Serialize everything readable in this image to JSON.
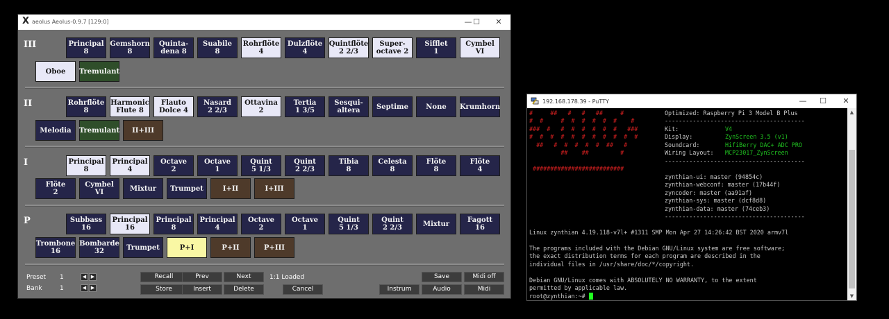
{
  "aeolus": {
    "title": "aeolus  Aeolus-0.9.7  [129:0]",
    "controls": {
      "minimize": "—",
      "maximize": "☐",
      "close": "✕"
    },
    "divisions": [
      {
        "label": "III",
        "row1": [
          {
            "name": "Principal\n8",
            "state": "off"
          },
          {
            "name": "Gemshorn\n8",
            "state": "off"
          },
          {
            "name": "Quinta-\ndena 8",
            "state": "off"
          },
          {
            "name": "Suabile\n8",
            "state": "off"
          },
          {
            "name": "Rohrflöte\n4",
            "state": "on"
          },
          {
            "name": "Dulzflöte\n4",
            "state": "off"
          },
          {
            "name": "Quintflöte\n2 2/3",
            "state": "on"
          },
          {
            "name": "Super-\noctave 2",
            "state": "on"
          },
          {
            "name": "Sifflet\n1",
            "state": "off"
          },
          {
            "name": "Cymbel\nVI",
            "state": "on"
          }
        ],
        "row2": [
          {
            "name": "Oboe",
            "state": "on"
          },
          {
            "name": "Tremulant",
            "state": "trem"
          }
        ]
      },
      {
        "label": "II",
        "row1": [
          {
            "name": "Rohrflöte\n8",
            "state": "off"
          },
          {
            "name": "Harmonic\nFlute 8",
            "state": "on"
          },
          {
            "name": "Flauto\nDolce 4",
            "state": "on"
          },
          {
            "name": "Nasard\n2 2/3",
            "state": "off"
          },
          {
            "name": "Ottavina\n2",
            "state": "on"
          },
          {
            "name": "Tertia\n1 3/5",
            "state": "off"
          },
          {
            "name": "Sesqui-\naltera",
            "state": "off"
          },
          {
            "name": "Septime",
            "state": "off"
          },
          {
            "name": "None",
            "state": "off"
          },
          {
            "name": "Krumhorn",
            "state": "off"
          }
        ],
        "row2": [
          {
            "name": "Melodia",
            "state": "off"
          },
          {
            "name": "Tremulant",
            "state": "trem"
          },
          {
            "name": "II+III",
            "state": "coup"
          }
        ]
      },
      {
        "label": "I",
        "row1": [
          {
            "name": "Principal\n8",
            "state": "on"
          },
          {
            "name": "Principal\n4",
            "state": "on"
          },
          {
            "name": "Octave\n2",
            "state": "off"
          },
          {
            "name": "Octave\n1",
            "state": "off"
          },
          {
            "name": "Quint\n5 1/3",
            "state": "off"
          },
          {
            "name": "Quint\n2 2/3",
            "state": "off"
          },
          {
            "name": "Tibia\n8",
            "state": "off"
          },
          {
            "name": "Celesta\n8",
            "state": "off"
          },
          {
            "name": "Flöte\n8",
            "state": "off"
          },
          {
            "name": "Flöte\n4",
            "state": "off"
          }
        ],
        "row2": [
          {
            "name": "Flöte\n2",
            "state": "off"
          },
          {
            "name": "Cymbel\nVI",
            "state": "off"
          },
          {
            "name": "Mixtur",
            "state": "off"
          },
          {
            "name": "Trumpet",
            "state": "off"
          },
          {
            "name": "I+II",
            "state": "coup"
          },
          {
            "name": "I+III",
            "state": "coup"
          }
        ]
      },
      {
        "label": "P",
        "row1": [
          {
            "name": "Subbass\n16",
            "state": "off"
          },
          {
            "name": "Principal\n16",
            "state": "on"
          },
          {
            "name": "Principal\n8",
            "state": "off"
          },
          {
            "name": "Principal\n4",
            "state": "off"
          },
          {
            "name": "Octave\n2",
            "state": "off"
          },
          {
            "name": "Octave\n1",
            "state": "off"
          },
          {
            "name": "Quint\n5 1/3",
            "state": "off"
          },
          {
            "name": "Quint\n2 2/3",
            "state": "off"
          },
          {
            "name": "Mixtur",
            "state": "off"
          },
          {
            "name": "Fagott\n16",
            "state": "off"
          }
        ],
        "row2": [
          {
            "name": "Trombone\n16",
            "state": "off"
          },
          {
            "name": "Bombarde\n32",
            "state": "off"
          },
          {
            "name": "Trumpet",
            "state": "off"
          },
          {
            "name": "P+I",
            "state": "coup-on"
          },
          {
            "name": "P+II",
            "state": "coup"
          },
          {
            "name": "P+III",
            "state": "coup"
          }
        ]
      }
    ],
    "control": {
      "preset_label": "Preset",
      "preset_value": "1",
      "bank_label": "Bank",
      "bank_value": "1",
      "left_arrow": "◀",
      "right_arrow": "▶",
      "recall": "Recall",
      "prev": "Prev",
      "next": "Next",
      "store": "Store",
      "insert": "Insert",
      "delete": "Delete",
      "status": "1:1  Loaded",
      "cancel": "Cancel",
      "save": "Save",
      "midi_off": "Midi off",
      "instrum": "Instrum",
      "audio": "Audio",
      "midi": "Midi"
    }
  },
  "putty": {
    "title": "192.168.178.39 - PuTTY",
    "controls": {
      "minimize": "—",
      "maximize": "☐",
      "close": "✕"
    },
    "logo_lines": [
      "#     ##   #   #   ##     #    ",
      "#  #     #  #  #  #  #  #    # ",
      "###  #   #  #  #  #  #  #   ###",
      "#  #  #  #  #  #  #  #  #  #  #",
      "  ##   #  #  #  #  #  ##   #  ",
      "         ##    ##         #    ",
      "                               ",
      " ##########################    "
    ],
    "info": {
      "optimized": "Optimized: Raspberry Pi 3 Model B Plus",
      "dash1": "----------------------------------------",
      "kit_label": "Kit:",
      "kit_value": "V4",
      "display_label": "Display:",
      "display_value": "ZynScreen 3.5 (v1)",
      "soundcard_label": "Soundcard:",
      "soundcard_value": "HifiBerry DAC+ ADC PRO",
      "wiring_label": "Wiring Layout:",
      "wiring_value": "MCP23017_ZynScreen",
      "dash2": "----------------------------------------",
      "ui": "zynthian-ui: master (94854c)",
      "webconf": "zynthian-webconf: master (17b44f)",
      "coder": "zyncoder: master (aa91af)",
      "sys": "zynthian-sys: master (dcf8d8)",
      "dataline": "zynthian-data: master (74ceb3)",
      "dash3": "----------------------------------------"
    },
    "linux": "Linux zynthian 4.19.118-v7l+ #1311 SMP Mon Apr 27 14:26:42 BST 2020 armv7l",
    "gnu1": "The programs included with the Debian GNU/Linux system are free software;",
    "gnu2": "the exact distribution terms for each program are described in the",
    "gnu3": "individual files in /usr/share/doc/*/copyright.",
    "warranty1": "Debian GNU/Linux comes with ABSOLUTELY NO WARRANTY, to the extent",
    "warranty2": "permitted by applicable law.",
    "prompt": "root@zynthian:~# ",
    "scroll_up": "▲",
    "scroll_down": "▼"
  }
}
